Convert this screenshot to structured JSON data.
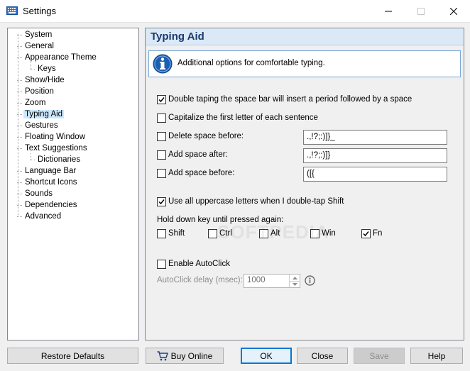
{
  "window": {
    "title": "Settings",
    "icons": [
      "keyboard-icon",
      "minimize-icon",
      "maximize-icon",
      "close-icon"
    ]
  },
  "tree": {
    "items": [
      {
        "label": "System"
      },
      {
        "label": "General"
      },
      {
        "label": "Appearance Theme"
      },
      {
        "label": "Keys"
      },
      {
        "label": "Show/Hide"
      },
      {
        "label": "Position"
      },
      {
        "label": "Zoom"
      },
      {
        "label": "Typing Aid",
        "selected": true
      },
      {
        "label": "Gestures"
      },
      {
        "label": "Floating Window"
      },
      {
        "label": "Text Suggestions"
      },
      {
        "label": "Dictionaries"
      },
      {
        "label": "Language Bar"
      },
      {
        "label": "Shortcut Icons"
      },
      {
        "label": "Sounds"
      },
      {
        "label": "Dependencies"
      },
      {
        "label": "Advanced"
      }
    ]
  },
  "panel": {
    "title": "Typing Aid",
    "info_icon": "info-icon",
    "info_text": "Additional options for comfortable typing.",
    "options": {
      "double_space": {
        "label": "Double taping the space bar will insert a period followed by a space",
        "checked": true
      },
      "capitalize": {
        "label": "Capitalize the first letter of each sentence",
        "checked": false
      },
      "delete_before": {
        "label": "Delete space before:",
        "checked": false,
        "value": ".,!?;:)]}_"
      },
      "add_after": {
        "label": "Add space after:",
        "checked": false,
        "value": ".,!?;:)]}"
      },
      "add_before": {
        "label": "Add space before:",
        "checked": false,
        "value": "([{"
      },
      "uppercase": {
        "label": "Use all uppercase letters when I double-tap Shift",
        "checked": true
      }
    },
    "hold_down": {
      "label": "Hold down key until pressed again:",
      "keys": [
        {
          "label": "Shift",
          "checked": false
        },
        {
          "label": "Ctrl",
          "checked": false
        },
        {
          "label": "Alt",
          "checked": false
        },
        {
          "label": "Win",
          "checked": false
        },
        {
          "label": "Fn",
          "checked": true
        }
      ]
    },
    "autoclick": {
      "label": "Enable AutoClick",
      "checked": false
    },
    "autoclick_delay": {
      "label": "AutoClick delay (msec):",
      "value": "1000"
    },
    "watermark": "SOFTPEDIA"
  },
  "buttons": {
    "restore": "Restore Defaults",
    "buy": "Buy Online",
    "buy_icon": "shopping-cart-icon",
    "ok": "OK",
    "close": "Close",
    "save": "Save",
    "help": "Help"
  },
  "colors": {
    "accent": "#0078d7",
    "header_bg": "#dbe9f7",
    "selection": "#cce8ff",
    "info_blue": "#1a5fb4"
  }
}
